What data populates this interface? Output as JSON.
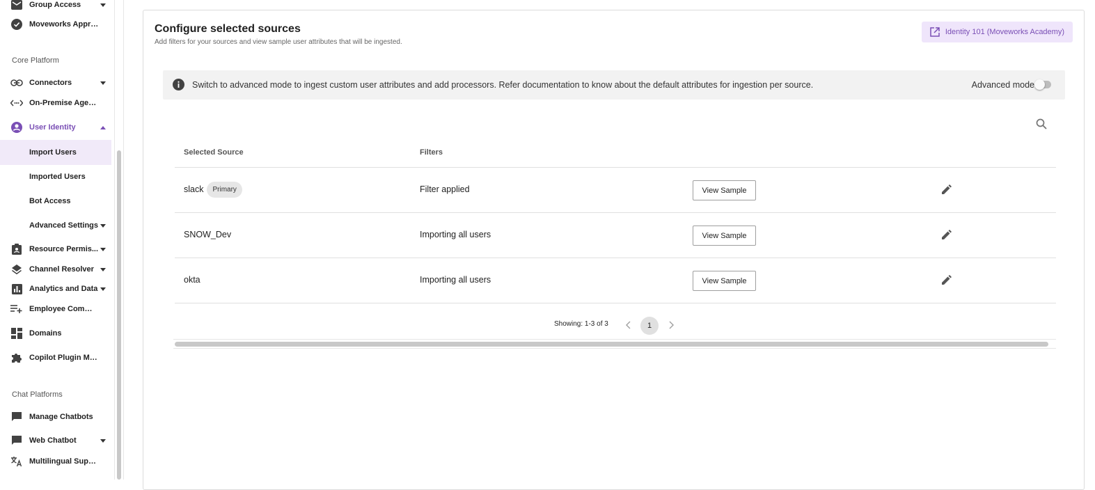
{
  "sidebar": {
    "top_items": [
      {
        "label": "Group Access",
        "icon": "mail-icon"
      },
      {
        "label": "Moveworks Appro...",
        "icon": "check-circle-icon"
      }
    ],
    "section_core": "Core Platform",
    "core_items": [
      {
        "label": "Connectors",
        "icon": "link-icon"
      },
      {
        "label": "On-Premise Agents",
        "icon": "code-dots-icon"
      },
      {
        "label": "User Identity",
        "icon": "account-circle-icon"
      }
    ],
    "user_identity_sub": [
      {
        "label": "Import Users"
      },
      {
        "label": "Imported Users"
      },
      {
        "label": "Bot Access"
      },
      {
        "label": "Advanced Settings"
      }
    ],
    "more_items": [
      {
        "label": "Resource Permis...",
        "icon": "badge-icon"
      },
      {
        "label": "Channel Resolver",
        "icon": "layers-icon"
      },
      {
        "label": "Analytics and Data",
        "icon": "bar-chart-icon"
      },
      {
        "label": "Employee Commu...",
        "icon": "playlist-add-icon"
      },
      {
        "label": "Domains",
        "icon": "dashboard-icon"
      },
      {
        "label": "Copilot Plugin Ma...",
        "icon": "puzzle-icon"
      }
    ],
    "section_chat": "Chat Platforms",
    "chat_items": [
      {
        "label": "Manage Chatbots",
        "icon": "chat-icon"
      },
      {
        "label": "Web Chatbot",
        "icon": "chat-icon"
      },
      {
        "label": "Multilingual Support",
        "icon": "translate-icon"
      }
    ]
  },
  "main": {
    "title": "Configure selected sources",
    "subtitle": "Add filters for your sources and view sample user attributes that will be ingested.",
    "academy_link": "Identity 101 (Moveworks Academy)",
    "info_text": "Switch to advanced mode to ingest custom user attributes and add processors. Refer documentation to know about the default attributes for ingestion per source.",
    "advanced_mode_label": "Advanced mode",
    "advanced_mode_on": false
  },
  "table": {
    "columns": [
      "Selected Source",
      "Filters"
    ],
    "rows": [
      {
        "source": "slack",
        "badge": "Primary",
        "filter": "Filter applied",
        "action": "View Sample"
      },
      {
        "source": "SNOW_Dev",
        "badge": "",
        "filter": "Importing all users",
        "action": "View Sample"
      },
      {
        "source": "okta",
        "badge": "",
        "filter": "Importing all users",
        "action": "View Sample"
      }
    ],
    "pagination": {
      "showing": "Showing: 1-3 of 3",
      "current_page": "1"
    }
  },
  "colors": {
    "accent": "#7a4fb5",
    "accent_bg": "#efe5fb",
    "selected_bg": "#f1eaf9"
  }
}
